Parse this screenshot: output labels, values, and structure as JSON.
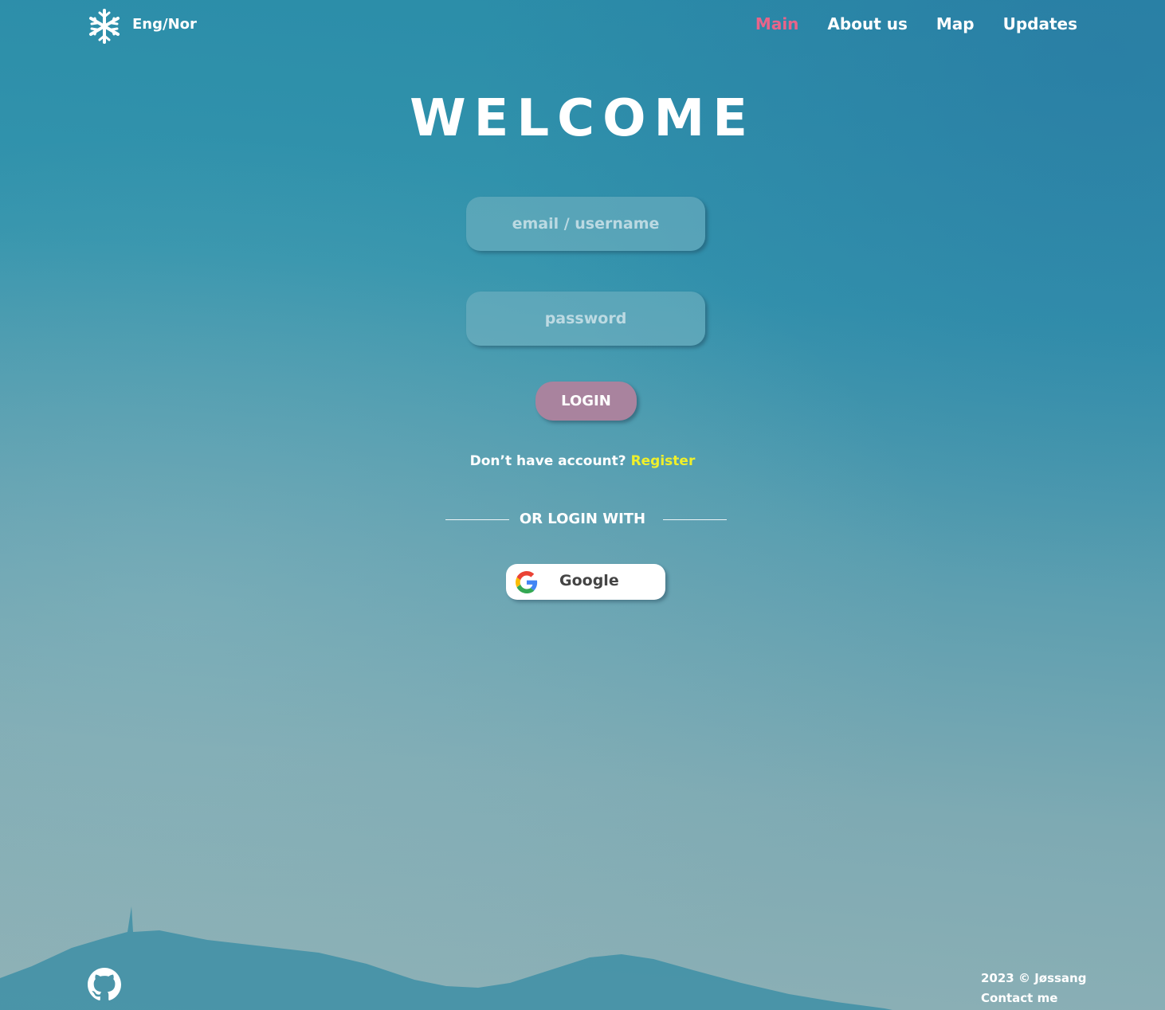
{
  "header": {
    "logo_icon": "snowflake-icon",
    "language_toggle": "Eng/Nor",
    "nav": [
      {
        "label": "Main",
        "active": true
      },
      {
        "label": "About us",
        "active": false
      },
      {
        "label": "Map",
        "active": false
      },
      {
        "label": "Updates",
        "active": false
      }
    ]
  },
  "main": {
    "title": "WELCOME",
    "email_placeholder": "email / username",
    "password_placeholder": "password",
    "login_label": "LOGIN",
    "no_account_text": "Don’t have account?",
    "register_link": "Register",
    "divider_text": "OR LOGIN WITH",
    "google_label": "Google",
    "google_icon": "google-icon"
  },
  "footer": {
    "github_icon": "github-icon",
    "copyright": "2023 © Jøssang",
    "contact": "Contact me"
  },
  "colors": {
    "active_nav": "#e8648a",
    "register_link": "#f0f02a",
    "login_button": "#a9839e"
  }
}
